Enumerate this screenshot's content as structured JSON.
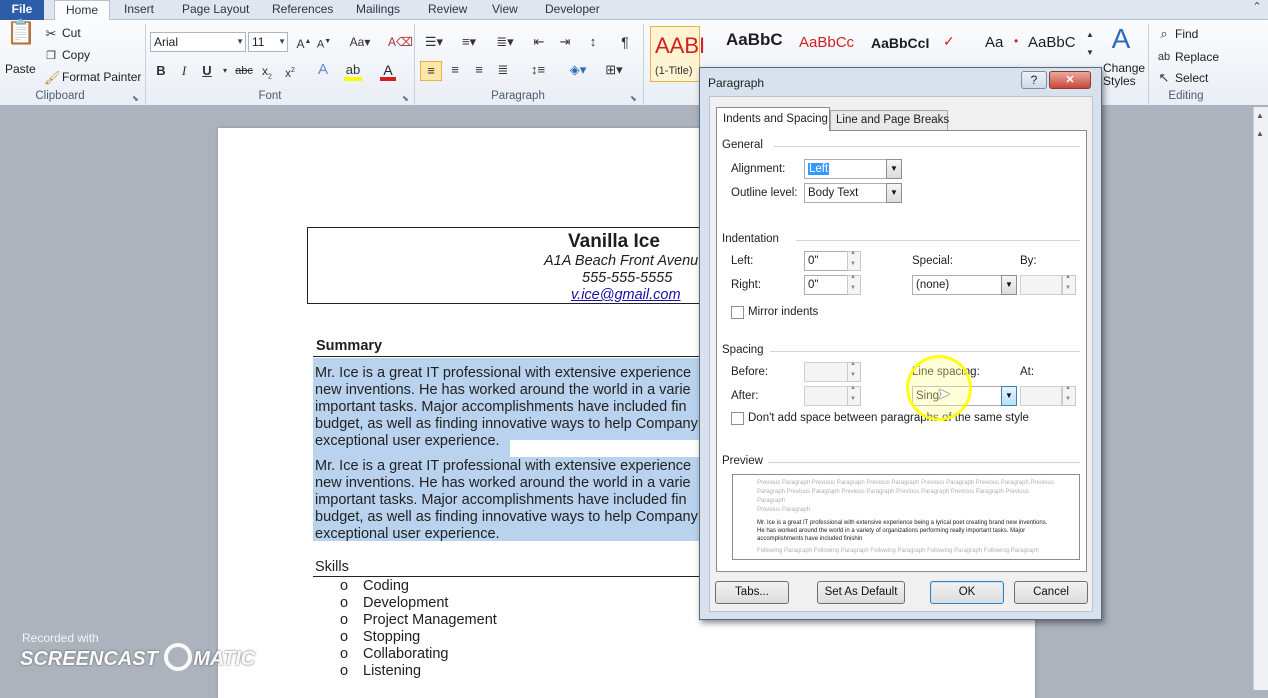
{
  "tabs": [
    "File",
    "Home",
    "Insert",
    "Page Layout",
    "References",
    "Mailings",
    "Review",
    "View",
    "Developer"
  ],
  "clipboard": {
    "paste": "Paste",
    "cut": "Cut",
    "copy": "Copy",
    "format_painter": "Format Painter",
    "group": "Clipboard"
  },
  "font": {
    "name": "Arial",
    "size": "11",
    "group": "Font"
  },
  "paragraph_group": "Paragraph",
  "styles": {
    "items": [
      "AABI",
      "AaBbC",
      "AaBbCc",
      "AaBbCcI",
      "Aa",
      "AaBbC"
    ],
    "first_label": "(1-Title)",
    "change_styles": "Change",
    "change_styles2": "Styles"
  },
  "editing": {
    "find": "Find",
    "replace": "Replace",
    "select": "Select",
    "group": "Editing"
  },
  "document": {
    "name": "Vanilla Ice",
    "address": "A1A Beach Front Avenu",
    "phone": "555-555-5555",
    "email": "v.ice@gmail.com",
    "summary_heading": "Summary",
    "para1": [
      "Mr. Ice is a great IT professional  with extensive experience",
      "new inventions.  He has worked around the world in a varie",
      "important tasks.  Major accomplishments have included fin",
      "budget, as well as finding innovative ways to help Company",
      "exceptional user experience."
    ],
    "para2": [
      "Mr. Ice is a great IT professional  with extensive experience",
      "new inventions.  He has worked around the world in a varie",
      "important tasks.  Major accomplishments have included fin",
      "budget, as well as finding innovative ways to help Company",
      "exceptional user experience."
    ],
    "skills_heading": "Skills",
    "skills": [
      "Coding",
      "Development",
      "Project Management",
      "Stopping",
      "Collaborating",
      "Listening"
    ],
    "bullet": "o"
  },
  "watermark": {
    "line1": "Recorded with",
    "line2": "SCREENCAST",
    "line3": "MATIC"
  },
  "dialog": {
    "title": "Paragraph",
    "help": "?",
    "close": "✕",
    "tab_indents": "Indents and Spacing",
    "tab_breaks": "Line and Page Breaks",
    "general": "General",
    "alignment_label": "Alignment:",
    "alignment_value": "Left",
    "outline_label": "Outline level:",
    "outline_value": "Body Text",
    "indentation": "Indentation",
    "left_label": "Left:",
    "left_value": "0\"",
    "right_label": "Right:",
    "right_value": "0\"",
    "special_label": "Special:",
    "special_value": "(none)",
    "by_label": "By:",
    "mirror": "Mirror indents",
    "spacing": "Spacing",
    "before_label": "Before:",
    "after_label": "After:",
    "line_spacing_label": "Line spacing:",
    "line_spacing_value": "Sing",
    "at_label": "At:",
    "dont_add": "Don't add space between paragraphs of the same style",
    "preview": "Preview",
    "preview_prev": "Previous Paragraph Previous Paragraph Previous Paragraph Previous Paragraph Previous Paragraph Previous Paragraph Previous Paragraph Previous Paragraph Previous Paragraph Previous Paragraph Previous Paragraph",
    "preview_prev2": "Previous Paragraph",
    "preview_text": "Mr. Ice is a great IT professional with extensive experience being a lyrical poet creating brand new inventions.  He has worked around the world in a variety of organizations performing really important tasks.  Major accomplishments have included finishin",
    "preview_next": "Following Paragraph Following Paragraph Following Paragraph Following Paragraph Following Paragraph",
    "tabs_btn": "Tabs...",
    "default_btn": "Set As Default",
    "ok_btn": "OK",
    "cancel_btn": "Cancel"
  },
  "colors": {
    "file_tab": "#2d5ca8",
    "highlight": "#b9d3ee",
    "cursor_ring": "#ffff00"
  }
}
